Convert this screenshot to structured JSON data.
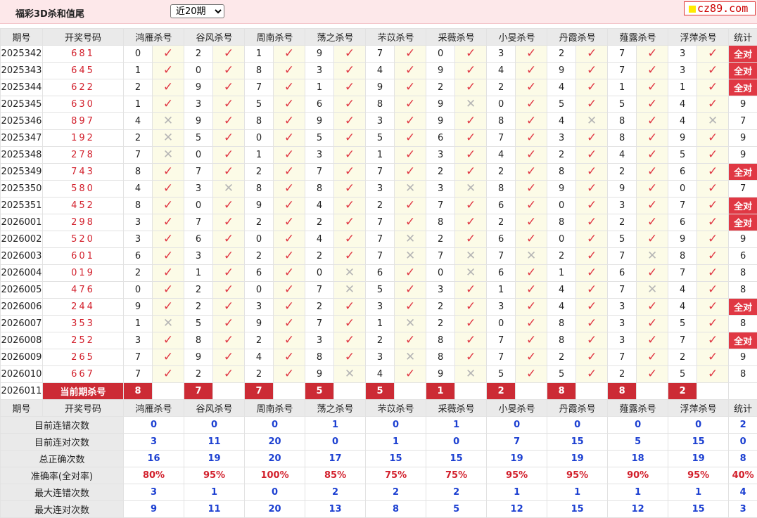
{
  "header": {
    "title": "福彩3D杀和值尾",
    "period_select": {
      "selected": "近20期",
      "options": [
        "近20期"
      ]
    },
    "logo_text": "cz89.com"
  },
  "columns": {
    "issue": "期号",
    "draw": "开奖号码",
    "experts": [
      "鸿雁杀号",
      "谷风杀号",
      "周南杀号",
      "荡之杀号",
      "芣苡杀号",
      "采薇杀号",
      "小旻杀号",
      "丹霞杀号",
      "薤露杀号",
      "浮萍杀号"
    ],
    "stat": "统计"
  },
  "all_correct_label": "全对",
  "rows": [
    {
      "issue": "2025342",
      "draw": "681",
      "picks": [
        [
          0,
          1
        ],
        [
          2,
          1
        ],
        [
          1,
          1
        ],
        [
          9,
          1
        ],
        [
          7,
          1
        ],
        [
          0,
          1
        ],
        [
          3,
          1
        ],
        [
          2,
          1
        ],
        [
          7,
          1
        ],
        [
          3,
          1
        ]
      ],
      "stat": "全对"
    },
    {
      "issue": "2025343",
      "draw": "645",
      "picks": [
        [
          1,
          1
        ],
        [
          0,
          1
        ],
        [
          8,
          1
        ],
        [
          3,
          1
        ],
        [
          4,
          1
        ],
        [
          9,
          1
        ],
        [
          4,
          1
        ],
        [
          9,
          1
        ],
        [
          7,
          1
        ],
        [
          3,
          1
        ]
      ],
      "stat": "全对"
    },
    {
      "issue": "2025344",
      "draw": "622",
      "picks": [
        [
          2,
          1
        ],
        [
          9,
          1
        ],
        [
          7,
          1
        ],
        [
          1,
          1
        ],
        [
          9,
          1
        ],
        [
          2,
          1
        ],
        [
          2,
          1
        ],
        [
          4,
          1
        ],
        [
          1,
          1
        ],
        [
          1,
          1
        ]
      ],
      "stat": "全对"
    },
    {
      "issue": "2025345",
      "draw": "630",
      "picks": [
        [
          1,
          1
        ],
        [
          3,
          1
        ],
        [
          5,
          1
        ],
        [
          6,
          1
        ],
        [
          8,
          1
        ],
        [
          9,
          0
        ],
        [
          0,
          1
        ],
        [
          5,
          1
        ],
        [
          5,
          1
        ],
        [
          4,
          1
        ]
      ],
      "stat": "9"
    },
    {
      "issue": "2025346",
      "draw": "897",
      "picks": [
        [
          4,
          0
        ],
        [
          9,
          1
        ],
        [
          8,
          1
        ],
        [
          9,
          1
        ],
        [
          3,
          1
        ],
        [
          9,
          1
        ],
        [
          8,
          1
        ],
        [
          4,
          0
        ],
        [
          8,
          1
        ],
        [
          4,
          0
        ]
      ],
      "stat": "7"
    },
    {
      "issue": "2025347",
      "draw": "192",
      "picks": [
        [
          2,
          0
        ],
        [
          5,
          1
        ],
        [
          0,
          1
        ],
        [
          5,
          1
        ],
        [
          5,
          1
        ],
        [
          6,
          1
        ],
        [
          7,
          1
        ],
        [
          3,
          1
        ],
        [
          8,
          1
        ],
        [
          9,
          1
        ]
      ],
      "stat": "9"
    },
    {
      "issue": "2025348",
      "draw": "278",
      "picks": [
        [
          7,
          0
        ],
        [
          0,
          1
        ],
        [
          1,
          1
        ],
        [
          3,
          1
        ],
        [
          1,
          1
        ],
        [
          3,
          1
        ],
        [
          4,
          1
        ],
        [
          2,
          1
        ],
        [
          4,
          1
        ],
        [
          5,
          1
        ]
      ],
      "stat": "9"
    },
    {
      "issue": "2025349",
      "draw": "743",
      "picks": [
        [
          8,
          1
        ],
        [
          7,
          1
        ],
        [
          2,
          1
        ],
        [
          7,
          1
        ],
        [
          7,
          1
        ],
        [
          2,
          1
        ],
        [
          2,
          1
        ],
        [
          8,
          1
        ],
        [
          2,
          1
        ],
        [
          6,
          1
        ]
      ],
      "stat": "全对"
    },
    {
      "issue": "2025350",
      "draw": "580",
      "picks": [
        [
          4,
          1
        ],
        [
          3,
          0
        ],
        [
          8,
          1
        ],
        [
          8,
          1
        ],
        [
          3,
          0
        ],
        [
          3,
          0
        ],
        [
          8,
          1
        ],
        [
          9,
          1
        ],
        [
          9,
          1
        ],
        [
          0,
          1
        ]
      ],
      "stat": "7"
    },
    {
      "issue": "2025351",
      "draw": "452",
      "picks": [
        [
          8,
          1
        ],
        [
          0,
          1
        ],
        [
          9,
          1
        ],
        [
          4,
          1
        ],
        [
          2,
          1
        ],
        [
          7,
          1
        ],
        [
          6,
          1
        ],
        [
          0,
          1
        ],
        [
          3,
          1
        ],
        [
          7,
          1
        ]
      ],
      "stat": "全对"
    },
    {
      "issue": "2026001",
      "draw": "298",
      "picks": [
        [
          3,
          1
        ],
        [
          7,
          1
        ],
        [
          2,
          1
        ],
        [
          2,
          1
        ],
        [
          7,
          1
        ],
        [
          8,
          1
        ],
        [
          2,
          1
        ],
        [
          8,
          1
        ],
        [
          2,
          1
        ],
        [
          6,
          1
        ]
      ],
      "stat": "全对"
    },
    {
      "issue": "2026002",
      "draw": "520",
      "picks": [
        [
          3,
          1
        ],
        [
          6,
          1
        ],
        [
          0,
          1
        ],
        [
          4,
          1
        ],
        [
          7,
          0
        ],
        [
          2,
          1
        ],
        [
          6,
          1
        ],
        [
          0,
          1
        ],
        [
          5,
          1
        ],
        [
          9,
          1
        ]
      ],
      "stat": "9"
    },
    {
      "issue": "2026003",
      "draw": "601",
      "picks": [
        [
          6,
          1
        ],
        [
          3,
          1
        ],
        [
          2,
          1
        ],
        [
          2,
          1
        ],
        [
          7,
          0
        ],
        [
          7,
          0
        ],
        [
          7,
          0
        ],
        [
          2,
          1
        ],
        [
          7,
          0
        ],
        [
          8,
          1
        ]
      ],
      "stat": "6"
    },
    {
      "issue": "2026004",
      "draw": "019",
      "picks": [
        [
          2,
          1
        ],
        [
          1,
          1
        ],
        [
          6,
          1
        ],
        [
          0,
          0
        ],
        [
          6,
          1
        ],
        [
          0,
          0
        ],
        [
          6,
          1
        ],
        [
          1,
          1
        ],
        [
          6,
          1
        ],
        [
          7,
          1
        ]
      ],
      "stat": "8"
    },
    {
      "issue": "2026005",
      "draw": "476",
      "picks": [
        [
          0,
          1
        ],
        [
          2,
          1
        ],
        [
          0,
          1
        ],
        [
          7,
          0
        ],
        [
          5,
          1
        ],
        [
          3,
          1
        ],
        [
          1,
          1
        ],
        [
          4,
          1
        ],
        [
          7,
          0
        ],
        [
          4,
          1
        ]
      ],
      "stat": "8"
    },
    {
      "issue": "2026006",
      "draw": "244",
      "picks": [
        [
          9,
          1
        ],
        [
          2,
          1
        ],
        [
          3,
          1
        ],
        [
          2,
          1
        ],
        [
          3,
          1
        ],
        [
          2,
          1
        ],
        [
          3,
          1
        ],
        [
          4,
          1
        ],
        [
          3,
          1
        ],
        [
          4,
          1
        ]
      ],
      "stat": "全对"
    },
    {
      "issue": "2026007",
      "draw": "353",
      "picks": [
        [
          1,
          0
        ],
        [
          5,
          1
        ],
        [
          9,
          1
        ],
        [
          7,
          1
        ],
        [
          1,
          0
        ],
        [
          2,
          1
        ],
        [
          0,
          1
        ],
        [
          8,
          1
        ],
        [
          3,
          1
        ],
        [
          5,
          1
        ]
      ],
      "stat": "8"
    },
    {
      "issue": "2026008",
      "draw": "252",
      "picks": [
        [
          3,
          1
        ],
        [
          8,
          1
        ],
        [
          2,
          1
        ],
        [
          3,
          1
        ],
        [
          2,
          1
        ],
        [
          8,
          1
        ],
        [
          7,
          1
        ],
        [
          8,
          1
        ],
        [
          3,
          1
        ],
        [
          7,
          1
        ]
      ],
      "stat": "全对"
    },
    {
      "issue": "2026009",
      "draw": "265",
      "picks": [
        [
          7,
          1
        ],
        [
          9,
          1
        ],
        [
          4,
          1
        ],
        [
          8,
          1
        ],
        [
          3,
          0
        ],
        [
          8,
          1
        ],
        [
          7,
          1
        ],
        [
          2,
          1
        ],
        [
          7,
          1
        ],
        [
          2,
          1
        ]
      ],
      "stat": "9"
    },
    {
      "issue": "2026010",
      "draw": "667",
      "picks": [
        [
          7,
          1
        ],
        [
          2,
          1
        ],
        [
          2,
          1
        ],
        [
          9,
          0
        ],
        [
          4,
          1
        ],
        [
          9,
          0
        ],
        [
          5,
          1
        ],
        [
          5,
          1
        ],
        [
          2,
          1
        ],
        [
          5,
          1
        ]
      ],
      "stat": "8"
    }
  ],
  "current": {
    "issue": "2026011",
    "label": "当前期杀号",
    "kills": [
      "8",
      "7",
      "7",
      "5",
      "5",
      "1",
      "2",
      "8",
      "8",
      "2"
    ]
  },
  "summary": [
    {
      "label": "目前连错次数",
      "values": [
        "0",
        "0",
        "0",
        "1",
        "0",
        "1",
        "0",
        "0",
        "0",
        "0"
      ],
      "stat": "2",
      "red": false
    },
    {
      "label": "目前连对次数",
      "values": [
        "3",
        "11",
        "20",
        "0",
        "1",
        "0",
        "7",
        "15",
        "5",
        "15"
      ],
      "stat": "0",
      "red": false
    },
    {
      "label": "总正确次数",
      "values": [
        "16",
        "19",
        "20",
        "17",
        "15",
        "15",
        "19",
        "19",
        "18",
        "19"
      ],
      "stat": "8",
      "red": false
    },
    {
      "label": "准确率(全对率)",
      "values": [
        "80%",
        "95%",
        "100%",
        "85%",
        "75%",
        "75%",
        "95%",
        "95%",
        "90%",
        "95%"
      ],
      "stat": "40%",
      "red": true
    },
    {
      "label": "最大连错次数",
      "values": [
        "3",
        "1",
        "0",
        "2",
        "2",
        "2",
        "1",
        "1",
        "1",
        "1"
      ],
      "stat": "4",
      "red": false
    },
    {
      "label": "最大连对次数",
      "values": [
        "9",
        "11",
        "20",
        "13",
        "8",
        "5",
        "12",
        "15",
        "12",
        "15"
      ],
      "stat": "3",
      "red": false
    }
  ],
  "colors": {
    "accent_red": "#e03844",
    "header_bg": "#fde8ea",
    "stat_blue": "#1b3fd1",
    "mark_bg": "#fcfbe7"
  }
}
